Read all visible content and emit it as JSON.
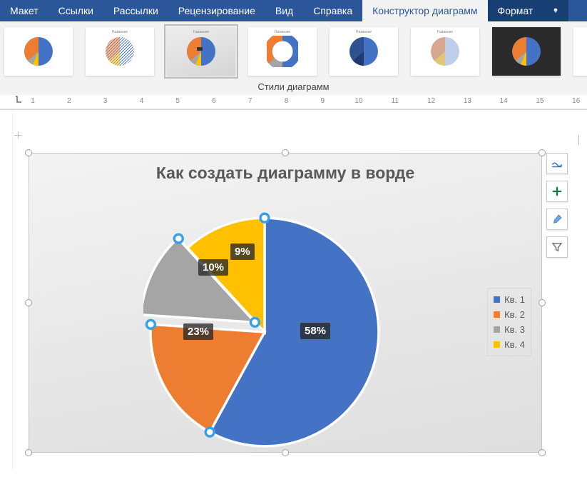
{
  "ribbon": {
    "tabs": [
      {
        "label": "Макет"
      },
      {
        "label": "Ссылки"
      },
      {
        "label": "Рассылки"
      },
      {
        "label": "Рецензирование"
      },
      {
        "label": "Вид"
      },
      {
        "label": "Справка"
      },
      {
        "label": "Конструктор диаграмм",
        "selected": true
      },
      {
        "label": "Формат",
        "dark": true
      }
    ]
  },
  "gallery": {
    "label": "Стили диаграмм"
  },
  "ruler": {
    "numbers": [
      "1",
      "2",
      "3",
      "4",
      "5",
      "6",
      "7",
      "8",
      "9",
      "10",
      "11",
      "12",
      "13",
      "14",
      "15",
      "16"
    ]
  },
  "chart_data": {
    "type": "pie",
    "title": "Как создать диаграмму в ворде",
    "series": [
      {
        "name": "Кв. 1",
        "value": 58,
        "color": "#4472c4",
        "label": "58%"
      },
      {
        "name": "Кв. 2",
        "value": 23,
        "color": "#ed7d31",
        "label": "23%"
      },
      {
        "name": "Кв. 3",
        "value": 10,
        "color": "#a5a5a5",
        "label": "10%"
      },
      {
        "name": "Кв. 4",
        "value": 9,
        "color": "#ffc000",
        "label": "9%"
      }
    ]
  },
  "legend": {
    "items": [
      "Кв. 1",
      "Кв. 2",
      "Кв. 3",
      "Кв. 4"
    ]
  },
  "side_icons": {
    "layout": "layout-options-icon",
    "plus": "plus-icon",
    "brush": "brush-icon",
    "filter": "filter-icon"
  }
}
